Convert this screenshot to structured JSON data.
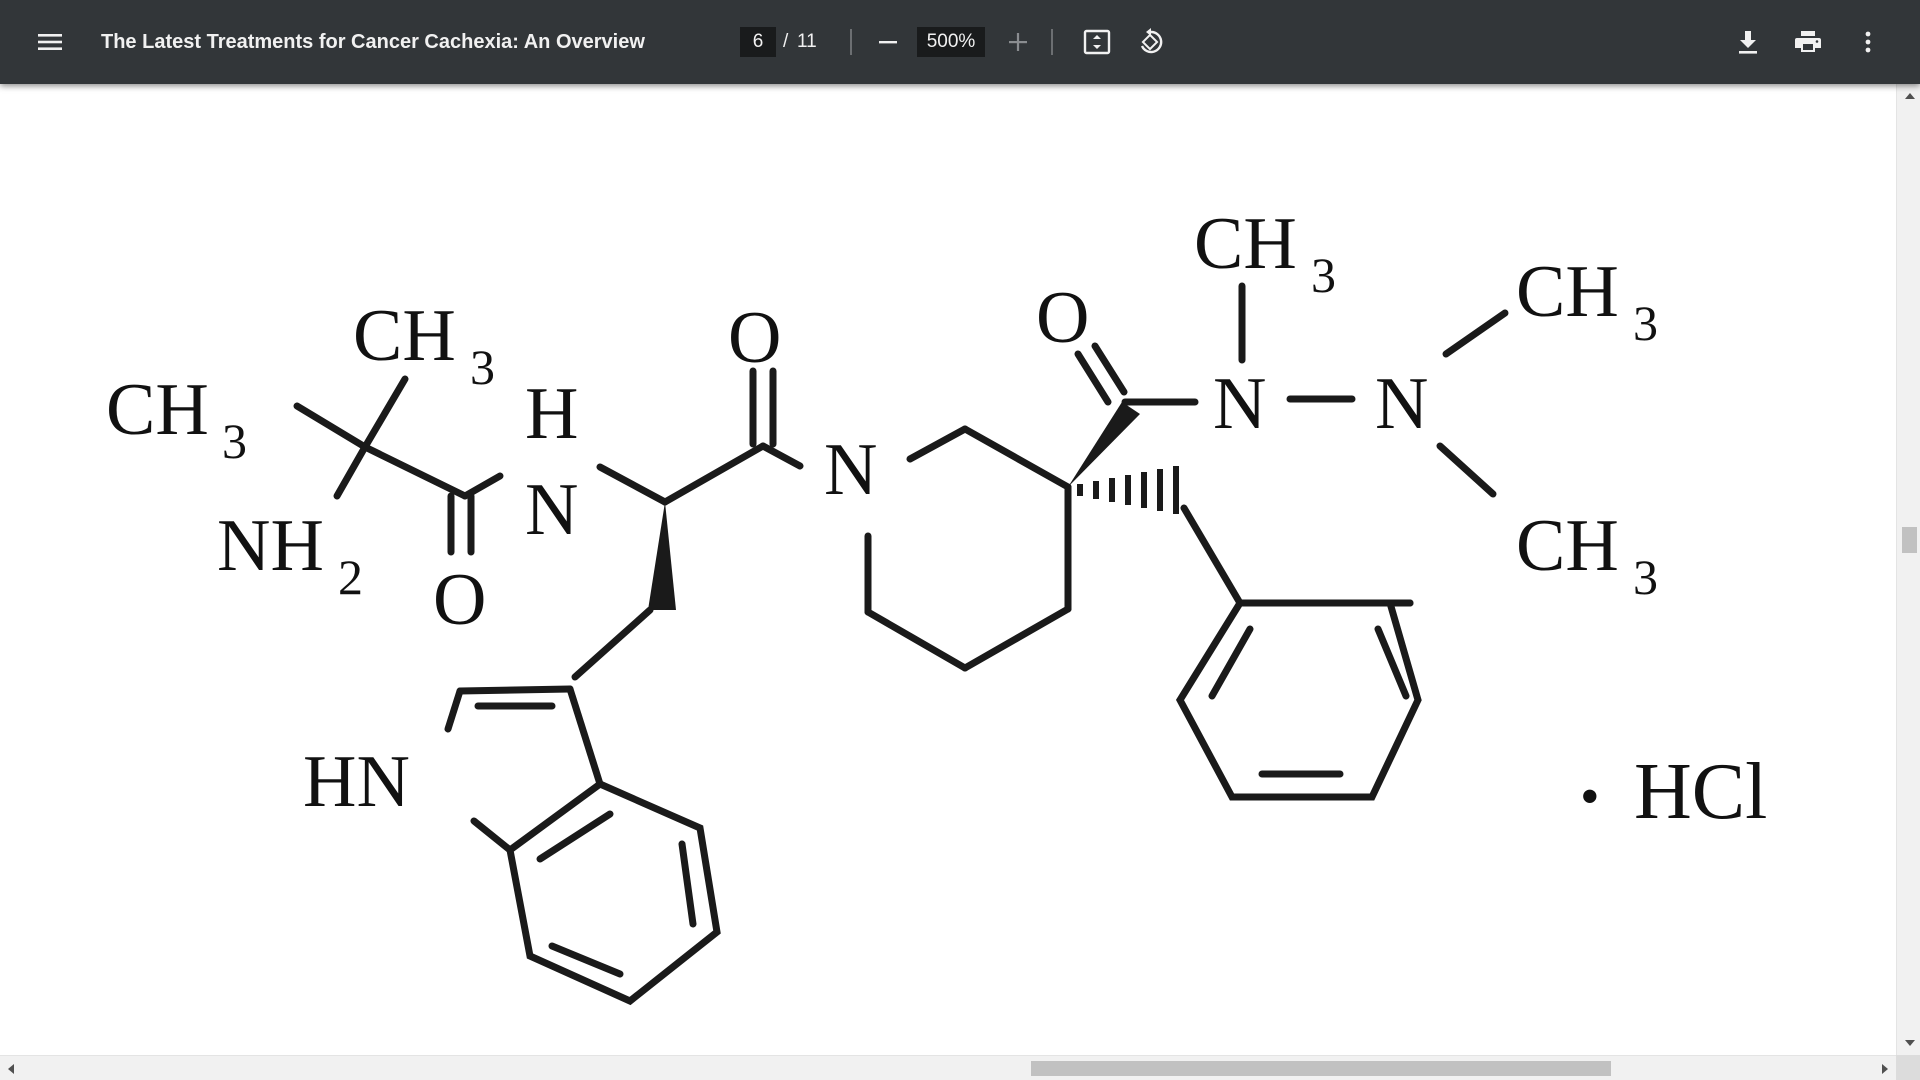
{
  "toolbar": {
    "menu_icon": "hamburger-menu-icon",
    "title": "The Latest Treatments for Cancer Cachexia: An Overview",
    "page_current": "6",
    "page_separator": "/",
    "page_total": "11",
    "zoom_out_icon": "minus-icon",
    "zoom_value": "500%",
    "zoom_in_icon": "plus-icon",
    "fit_icon": "fit-to-page-icon",
    "rotate_icon": "rotate-counterclockwise-icon",
    "download_icon": "download-icon",
    "print_icon": "print-icon",
    "more_icon": "more-vertical-icon",
    "background_color": "#323639"
  },
  "structure": {
    "labels": {
      "ch3_left": "CH",
      "ch3_left_sub": "3",
      "ch3_top": "CH",
      "ch3_top_sub": "3",
      "nh2": "NH",
      "nh2_sub": "2",
      "o_amide1": "O",
      "h": "H",
      "n_amide": "N",
      "o_amide2": "O",
      "n_piperidine": "N",
      "o_hydrazide": "O",
      "ch3_n": "CH",
      "ch3_n_sub": "3",
      "n1": "N",
      "n2": "N",
      "ch3_right_top": "CH",
      "ch3_right_top_sub": "3",
      "ch3_right_bottom": "CH",
      "ch3_right_bottom_sub": "3",
      "hn_indole": "HN",
      "salt_dot": "•",
      "salt": "HCl"
    }
  },
  "scrollbars": {
    "vertical_thumb_fraction": 0.03,
    "horizontal_thumb_fraction": 0.31
  }
}
